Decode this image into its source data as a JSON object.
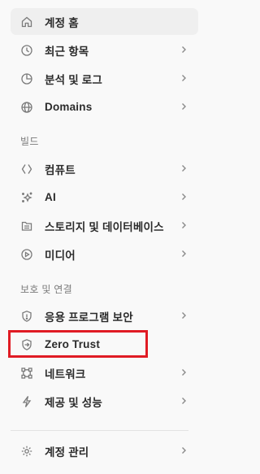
{
  "nav": {
    "items": [
      {
        "label": "계정 홈",
        "icon": "home-icon",
        "active": true,
        "chevron": false
      },
      {
        "label": "최근 항목",
        "icon": "clock-icon",
        "active": false,
        "chevron": true
      },
      {
        "label": "분석 및 로그",
        "icon": "pie-chart-icon",
        "active": false,
        "chevron": true
      },
      {
        "label": "Domains",
        "icon": "globe-icon",
        "active": false,
        "chevron": true
      },
      {
        "label": "컴퓨트",
        "icon": "compute-icon",
        "active": false,
        "chevron": true
      },
      {
        "label": "AI",
        "icon": "sparkles-icon",
        "active": false,
        "chevron": true
      },
      {
        "label": "스토리지 및 데이터베이스",
        "icon": "storage-icon",
        "active": false,
        "chevron": true
      },
      {
        "label": "미디어",
        "icon": "media-play-icon",
        "active": false,
        "chevron": true
      },
      {
        "label": "응용 프로그램 보안",
        "icon": "shield-icon",
        "active": false,
        "chevron": true
      },
      {
        "label": "Zero Trust",
        "icon": "zero-trust-icon",
        "active": false,
        "chevron": false,
        "highlighted": true
      },
      {
        "label": "네트워크",
        "icon": "network-icon",
        "active": false,
        "chevron": true
      },
      {
        "label": "제공 및 성능",
        "icon": "lightning-icon",
        "active": false,
        "chevron": true
      },
      {
        "label": "계정 관리",
        "icon": "gear-icon",
        "active": false,
        "chevron": true
      }
    ],
    "sections": {
      "build": "빌드",
      "protect": "보호 및 연결"
    }
  },
  "colors": {
    "background": "#f9f9f9",
    "active_bg": "#efefef",
    "highlight_border": "#e01b24",
    "icon": "#7a7a7a"
  }
}
